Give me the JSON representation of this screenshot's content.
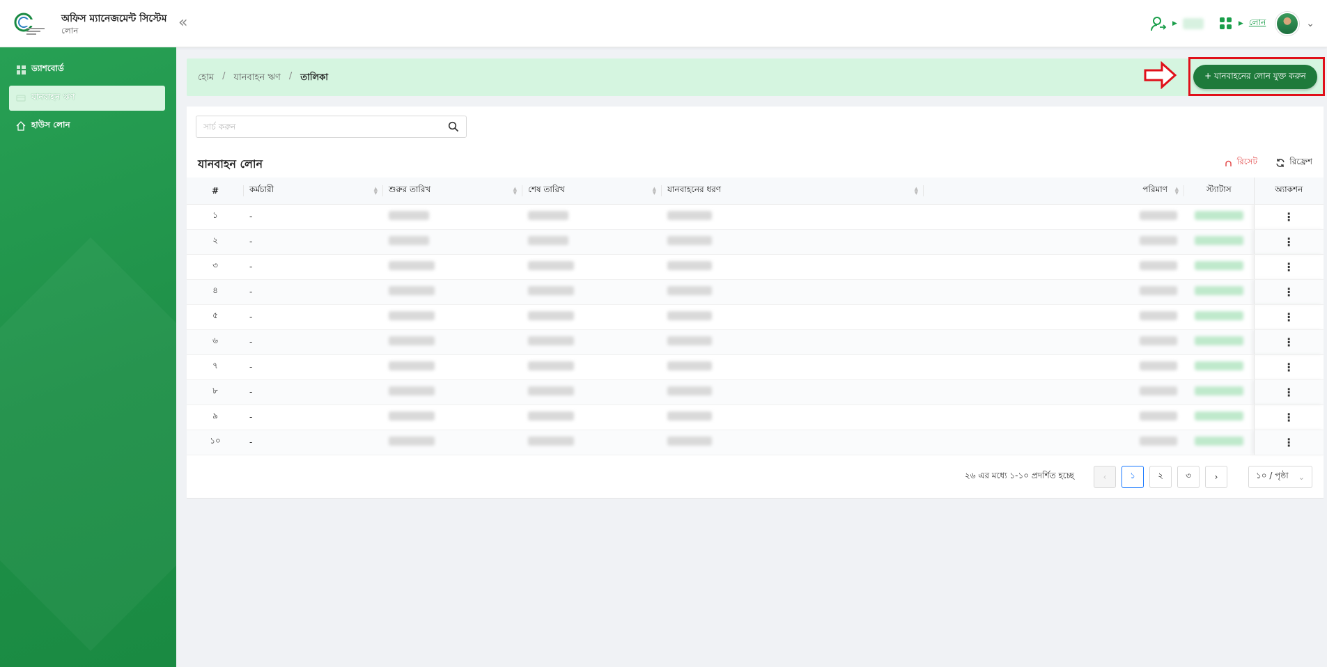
{
  "header": {
    "app_title": "অফিস ম্যানেজমেন্ট সিস্টেম",
    "app_subtitle": "লোন",
    "collapse_icon": "double-chevron-left-icon",
    "loan_link": "লোন"
  },
  "sidebar": {
    "items": [
      {
        "label": "ড্যাশবোর্ড",
        "icon": "dashboard-icon",
        "active": false
      },
      {
        "label": "যানবাহন ঋণ",
        "icon": "car-icon",
        "active": true
      },
      {
        "label": "হাউস লোন",
        "icon": "home-icon",
        "active": false
      }
    ]
  },
  "breadcrumb": {
    "items": [
      "হোম",
      "যানবাহন ঋণ",
      "তালিকা"
    ],
    "separator": "/"
  },
  "add_button": {
    "label": "+ যানবাহনের লোন যুক্ত করুন"
  },
  "search": {
    "placeholder": "সার্চ করুন"
  },
  "table": {
    "title": "যানবাহন লোন",
    "reset_label": "রিসেট",
    "refresh_label": "রিফ্রেশ",
    "columns": [
      "#",
      "কর্মচারী",
      "শুরুর তারিখ",
      "শেষ তারিখ",
      "যানবাহনের ধরণ",
      "পরিমাণ",
      "স্ট্যাটাস",
      "অ্যাকশন"
    ],
    "rows": [
      {
        "index": "১",
        "employee": "-"
      },
      {
        "index": "২",
        "employee": "-"
      },
      {
        "index": "৩",
        "employee": "-"
      },
      {
        "index": "৪",
        "employee": "-"
      },
      {
        "index": "৫",
        "employee": "-"
      },
      {
        "index": "৬",
        "employee": "-"
      },
      {
        "index": "৭",
        "employee": "-"
      },
      {
        "index": "৮",
        "employee": "-"
      },
      {
        "index": "৯",
        "employee": "-"
      },
      {
        "index": "১০",
        "employee": "-"
      }
    ]
  },
  "pagination": {
    "summary": "২৬ এর মধ্যে ১-১০ প্রদর্শিত হচ্ছে",
    "pages": [
      "১",
      "২",
      "৩"
    ],
    "current_page": "১",
    "page_size": "১০ / পৃষ্ঠা"
  },
  "colors": {
    "brand_green": "#1e7a3b",
    "sidebar_green": "#1f9048",
    "breadcrumb_bg": "#d5f5e0",
    "annotation_red": "#e0101a"
  }
}
